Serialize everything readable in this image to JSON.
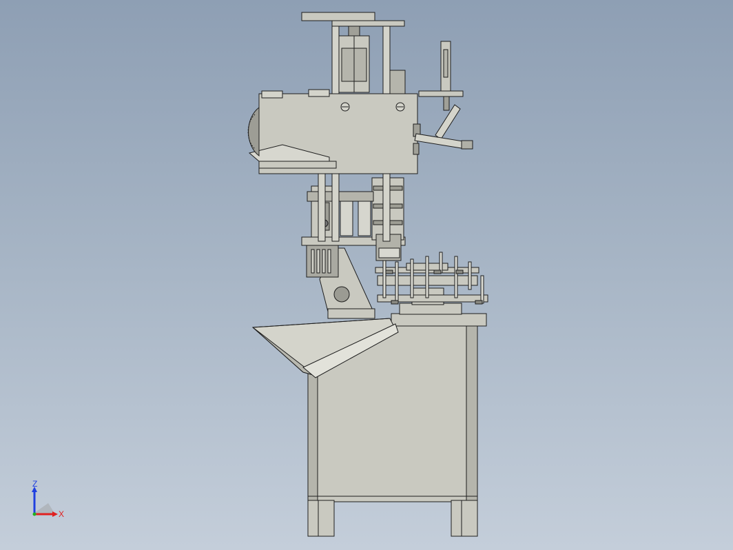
{
  "colors": {
    "background_top": "#8e9fb4",
    "background_bottom": "#c4ceda",
    "part_fill": "#c9c9c0",
    "part_shade": "#a7a79e",
    "edge": "#1d1d1d",
    "axis_x": "#e02020",
    "axis_y": "#20b020",
    "axis_z": "#2040e0"
  },
  "triad": {
    "x_label": "X",
    "z_label": "Z"
  }
}
